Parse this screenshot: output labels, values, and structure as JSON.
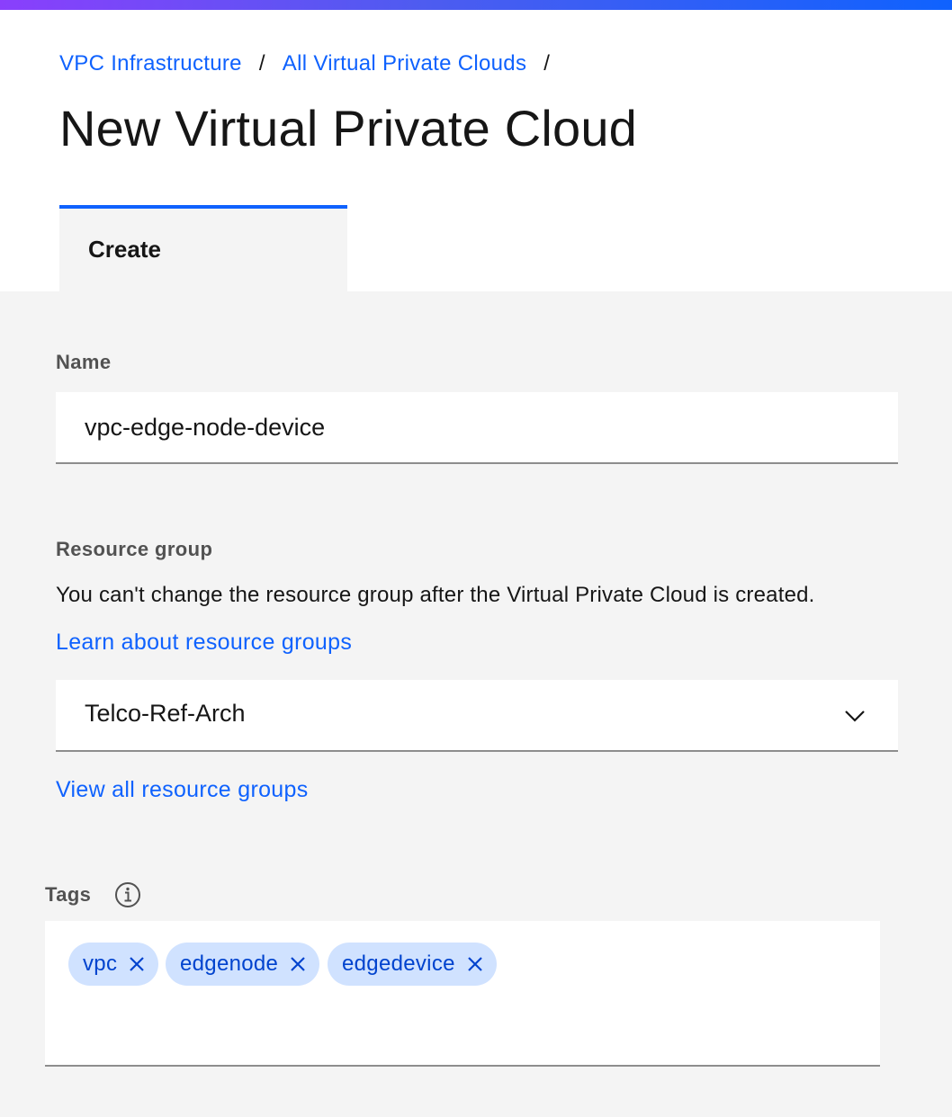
{
  "breadcrumb": {
    "items": [
      "VPC Infrastructure",
      "All Virtual Private Clouds"
    ],
    "separator": "/"
  },
  "page": {
    "title": "New Virtual Private Cloud"
  },
  "tabs": [
    {
      "label": "Create",
      "selected": true
    }
  ],
  "form": {
    "name": {
      "label": "Name",
      "value": "vpc-edge-node-device"
    },
    "resource_group": {
      "label": "Resource group",
      "helper": "You can't change the resource group after the Virtual Private Cloud is created.",
      "learn_link": "Learn about resource groups",
      "selected": "Telco-Ref-Arch",
      "view_all_link": "View all resource groups"
    },
    "tags": {
      "label": "Tags",
      "items": [
        "vpc",
        "edgenode",
        "edgedevice"
      ]
    }
  },
  "icons": {
    "dropdown": "chevron-down-icon",
    "tag_remove": "close-icon",
    "tags_info": "info-icon"
  },
  "colors": {
    "accent": "#0f62fe",
    "tag_background": "#d0e2ff",
    "tag_text": "#0043ce",
    "page_background": "#f4f4f4"
  }
}
